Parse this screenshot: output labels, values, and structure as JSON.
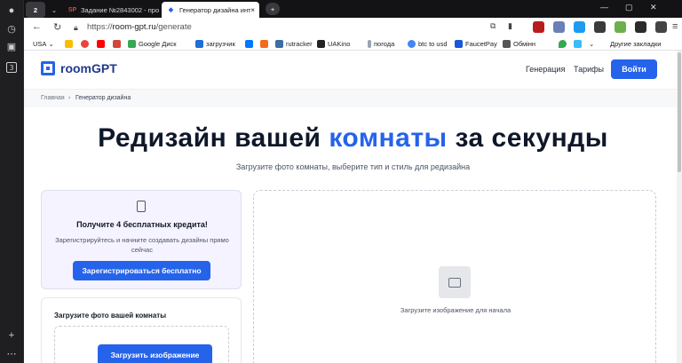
{
  "browser": {
    "tabs": [
      {
        "label": "Задание №2843002 - про",
        "favicon": "SP"
      },
      {
        "label": "Генератор дизайна инт",
        "favicon": "roomgpt-icon"
      }
    ],
    "tab_count_badge": "2",
    "sidebar_badge": "3",
    "url_scheme": "https://",
    "url_host": "room-gpt.ru",
    "url_path": "/generate",
    "bookmarks": [
      "USA",
      "Google Диск",
      "загрузчик",
      "rutracker",
      "UAKino",
      "погода",
      "btc to usd",
      "FaucetPay",
      "Обмінн"
    ],
    "other_bookmarks": "Другие закладки",
    "colors": {
      "accent": "#2563eb"
    }
  },
  "site": {
    "logo": "roomGPT",
    "nav": [
      "Генерация",
      "Тарифы"
    ],
    "login": "Войти",
    "crumbs": [
      "Главная",
      "›",
      "Генератор дизайна"
    ],
    "hero_before": "Редизайн вашей ",
    "hero_accent": "комнаты",
    "hero_after": " за секунды",
    "hero_sub": "Загрузите фото комнаты, выберите тип и стиль для редизайна",
    "credit_title": "Получите 4 бесплатных кредита!",
    "credit_desc": "Зарегистрируйтесь и начните создавать дизайны прямо сейчас",
    "register_btn": "Зарегистрироваться бесплатно",
    "upload_title": "Загрузите фото вашей комнаты",
    "upload_btn": "Загрузить изображение",
    "preview_caption": "Загрузите изображение для начала"
  }
}
